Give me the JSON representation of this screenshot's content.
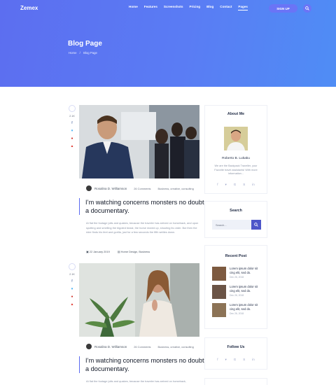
{
  "header": {
    "logo": "Zemex",
    "nav": [
      "Home",
      "Features",
      "Screenshots",
      "Pricing",
      "Blog",
      "Contact",
      "Pages"
    ],
    "signup": "SIGN UP"
  },
  "hero": {
    "title": "Blog Page",
    "breadcrumb_home": "Home",
    "breadcrumb_sep": "/",
    "breadcrumb_current": "Blog Page"
  },
  "posts": [
    {
      "likes": "2.1K",
      "author": "Rosalina D. Williamson",
      "comments": "26 Comments",
      "tags": "Business, creative, consulting",
      "title": "I’m watching concerns monsters no doubt a documentary.",
      "excerpt": "At flat the footage jolts and quakes, because the traveler has arrived on horseback, and upon spotting and smelling the bigoted beast, the horse reared up, shouting its order. But then the rider finds his feet and gorilla, just for a few seconds the fifth settles down.",
      "date": "22 January 2019",
      "categories": "Home Design, Business"
    },
    {
      "likes": "2.1K",
      "author": "Rosalina D. Williamson",
      "comments": "26 Comments",
      "tags": "Business, creative, consulting",
      "title": "I’m watching concerns monsters no doubt a documentary.",
      "excerpt": "At flat the footage jolts and quakes, because the traveler has arrived on horseback,"
    }
  ],
  "sidebar": {
    "about_title": "About Me",
    "about_name": "Roberto B. Lukaku",
    "about_text": "We are the Backpack Traveller, your Favorite travel assistants! With more information...",
    "search_title": "Search",
    "search_placeholder": "Search...",
    "recent_title": "Recent Post",
    "recent": [
      {
        "title": "Lorem ipsum dolor sit cing elit, sed do.",
        "date": "Dec 26, 2018"
      },
      {
        "title": "Lorem ipsum dolor sit cing elit, sed do.",
        "date": "Dec 26, 2018"
      },
      {
        "title": "Lorem ipsum dolor sit cing elit, sed do.",
        "date": "Dec 26, 2018"
      }
    ],
    "follow_title": "Follow Us"
  },
  "colors": {
    "accent": "#5b6af0",
    "hero_start": "#5c6ef0",
    "hero_end": "#4f8df5"
  }
}
